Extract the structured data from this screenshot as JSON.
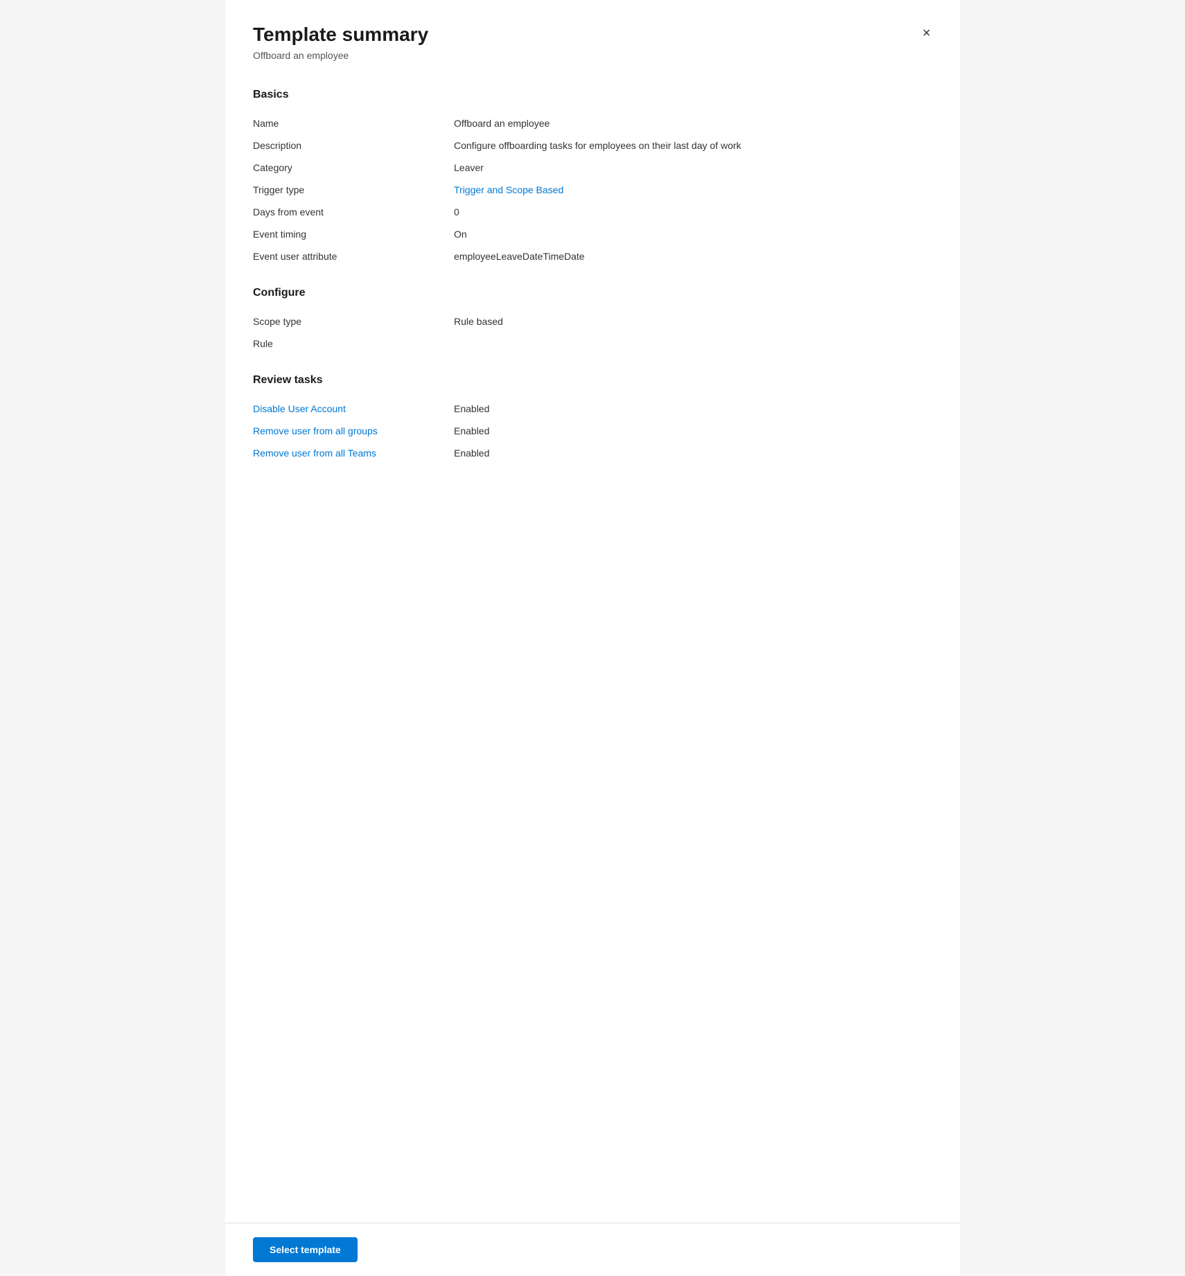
{
  "panel": {
    "title": "Template summary",
    "subtitle": "Offboard an employee"
  },
  "close_button_label": "×",
  "sections": {
    "basics": {
      "heading": "Basics",
      "fields": [
        {
          "label": "Name",
          "value": "Offboard an employee",
          "link": false
        },
        {
          "label": "Description",
          "value": "Configure offboarding tasks for employees on their last day of work",
          "link": false
        },
        {
          "label": "Category",
          "value": "Leaver",
          "link": false
        },
        {
          "label": "Trigger type",
          "value": "Trigger and Scope Based",
          "link": true
        },
        {
          "label": "Days from event",
          "value": "0",
          "link": false
        },
        {
          "label": "Event timing",
          "value": "On",
          "link": false
        },
        {
          "label": "Event user attribute",
          "value": "employeeLeaveDateTimeDate",
          "link": false
        }
      ]
    },
    "configure": {
      "heading": "Configure",
      "fields": [
        {
          "label": "Scope type",
          "value": "Rule based",
          "link": false
        },
        {
          "label": "Rule",
          "value": "",
          "link": false
        }
      ]
    },
    "review_tasks": {
      "heading": "Review tasks",
      "fields": [
        {
          "label": "Disable User Account",
          "value": "Enabled",
          "link": true
        },
        {
          "label": "Remove user from all groups",
          "value": "Enabled",
          "link": true
        },
        {
          "label": "Remove user from all Teams",
          "value": "Enabled",
          "link": true
        }
      ]
    }
  },
  "footer": {
    "select_template_label": "Select template"
  }
}
